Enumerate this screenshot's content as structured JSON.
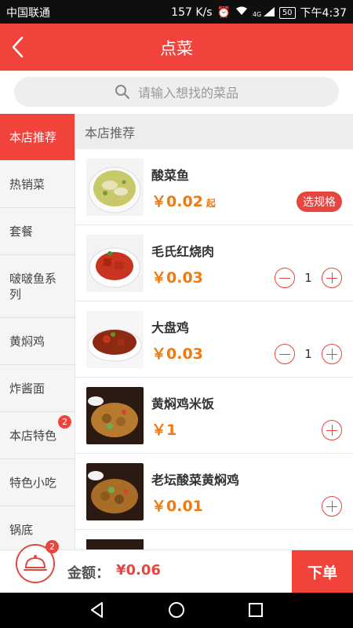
{
  "status": {
    "carrier": "中国联通",
    "speed": "157 K/s",
    "network": "4G",
    "battery": "50",
    "time": "下午4:37"
  },
  "header": {
    "title": "点菜",
    "back_icon": "chevron-left-icon"
  },
  "search": {
    "placeholder": "请输入想找的菜品"
  },
  "sidebar": {
    "items": [
      {
        "label": "本店推荐",
        "active": true
      },
      {
        "label": "热销菜"
      },
      {
        "label": "套餐"
      },
      {
        "label": "啵啵鱼系列"
      },
      {
        "label": "黄焖鸡"
      },
      {
        "label": "炸酱面"
      },
      {
        "label": "本店特色",
        "badge": "2"
      },
      {
        "label": "特色小吃"
      },
      {
        "label": "锅底"
      }
    ]
  },
  "main": {
    "section_title": "本店推荐",
    "dishes": [
      {
        "name": "酸菜鱼",
        "price": "￥0.02",
        "suffix": "起",
        "action": "选规格"
      },
      {
        "name": "毛氏红烧肉",
        "price": "￥0.03",
        "qty": "1"
      },
      {
        "name": "大盘鸡",
        "price": "￥0.03",
        "qty": "1"
      },
      {
        "name": "黄焖鸡米饭",
        "price": "￥1"
      },
      {
        "name": "老坛酸菜黄焖鸡",
        "price": "￥0.01"
      }
    ]
  },
  "cart": {
    "badge": "2",
    "total_label": "金额：",
    "total_value": "¥0.06",
    "order_label": "下单"
  },
  "colors": {
    "brand": "#f2423c",
    "price": "#f07a0f"
  }
}
